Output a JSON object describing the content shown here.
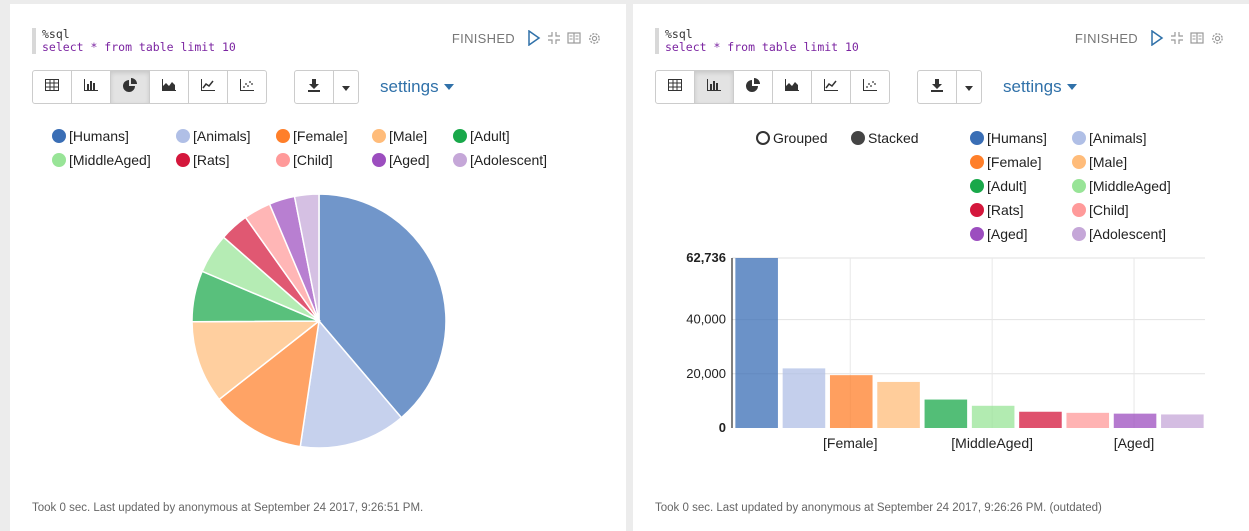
{
  "colors": {
    "Humans": "#3a6eb5",
    "Animals": "#b0bfe6",
    "Female": "#ff7f2a",
    "Male": "#ffbc7a",
    "Adult": "#19a84a",
    "MiddleAged": "#98e497",
    "Rats": "#d4173c",
    "Child": "#ff9a9a",
    "Aged": "#9c4ebf",
    "Adolescent": "#c5a7d8"
  },
  "left": {
    "editor": {
      "lang": "%sql",
      "query": "select * from table limit 10"
    },
    "status": "FINISHED",
    "settings_label": "settings",
    "legend": [
      "[Humans]",
      "[Animals]",
      "[Female]",
      "[Male]",
      "[Adult]",
      "[MiddleAged]",
      "[Rats]",
      "[Child]",
      "[Aged]",
      "[Adolescent]"
    ],
    "footer": "Took 0 sec. Last updated by anonymous at September 24 2017, 9:26:51 PM."
  },
  "right": {
    "editor": {
      "lang": "%sql",
      "query": "select * from table limit 10"
    },
    "status": "FINISHED",
    "settings_label": "settings",
    "grouped_label": "Grouped",
    "stacked_label": "Stacked",
    "legend": [
      "[Humans]",
      "[Animals]",
      "[Female]",
      "[Male]",
      "[Adult]",
      "[MiddleAged]",
      "[Rats]",
      "[Child]",
      "[Aged]",
      "[Adolescent]"
    ],
    "footer": "Took 0 sec. Last updated by anonymous at September 24 2017, 9:26:26 PM. (outdated)"
  },
  "chart_data": [
    {
      "type": "pie",
      "categories": [
        "[Humans]",
        "[Animals]",
        "[Female]",
        "[Male]",
        "[Adult]",
        "[MiddleAged]",
        "[Rats]",
        "[Child]",
        "[Aged]",
        "[Adolescent]"
      ],
      "values": [
        62736,
        22000,
        19500,
        17000,
        10500,
        8200,
        6000,
        5600,
        5300,
        5000
      ]
    },
    {
      "type": "bar",
      "categories": [
        "[Humans]",
        "[Animals]",
        "[Female]",
        "[Male]",
        "[Adult]",
        "[MiddleAged]",
        "[Rats]",
        "[Child]",
        "[Aged]",
        "[Adolescent]"
      ],
      "values": [
        62736,
        22000,
        19500,
        17000,
        10500,
        8200,
        6000,
        5600,
        5300,
        5000
      ],
      "ylim": [
        0,
        62736
      ],
      "yticks": [
        "0",
        "20,000",
        "40,000",
        "62,736"
      ],
      "ytick_values": [
        0,
        20000,
        40000,
        62736
      ],
      "xtick_labels": [
        "[Female]",
        "[MiddleAged]",
        "[Aged]"
      ],
      "grid": true
    }
  ]
}
